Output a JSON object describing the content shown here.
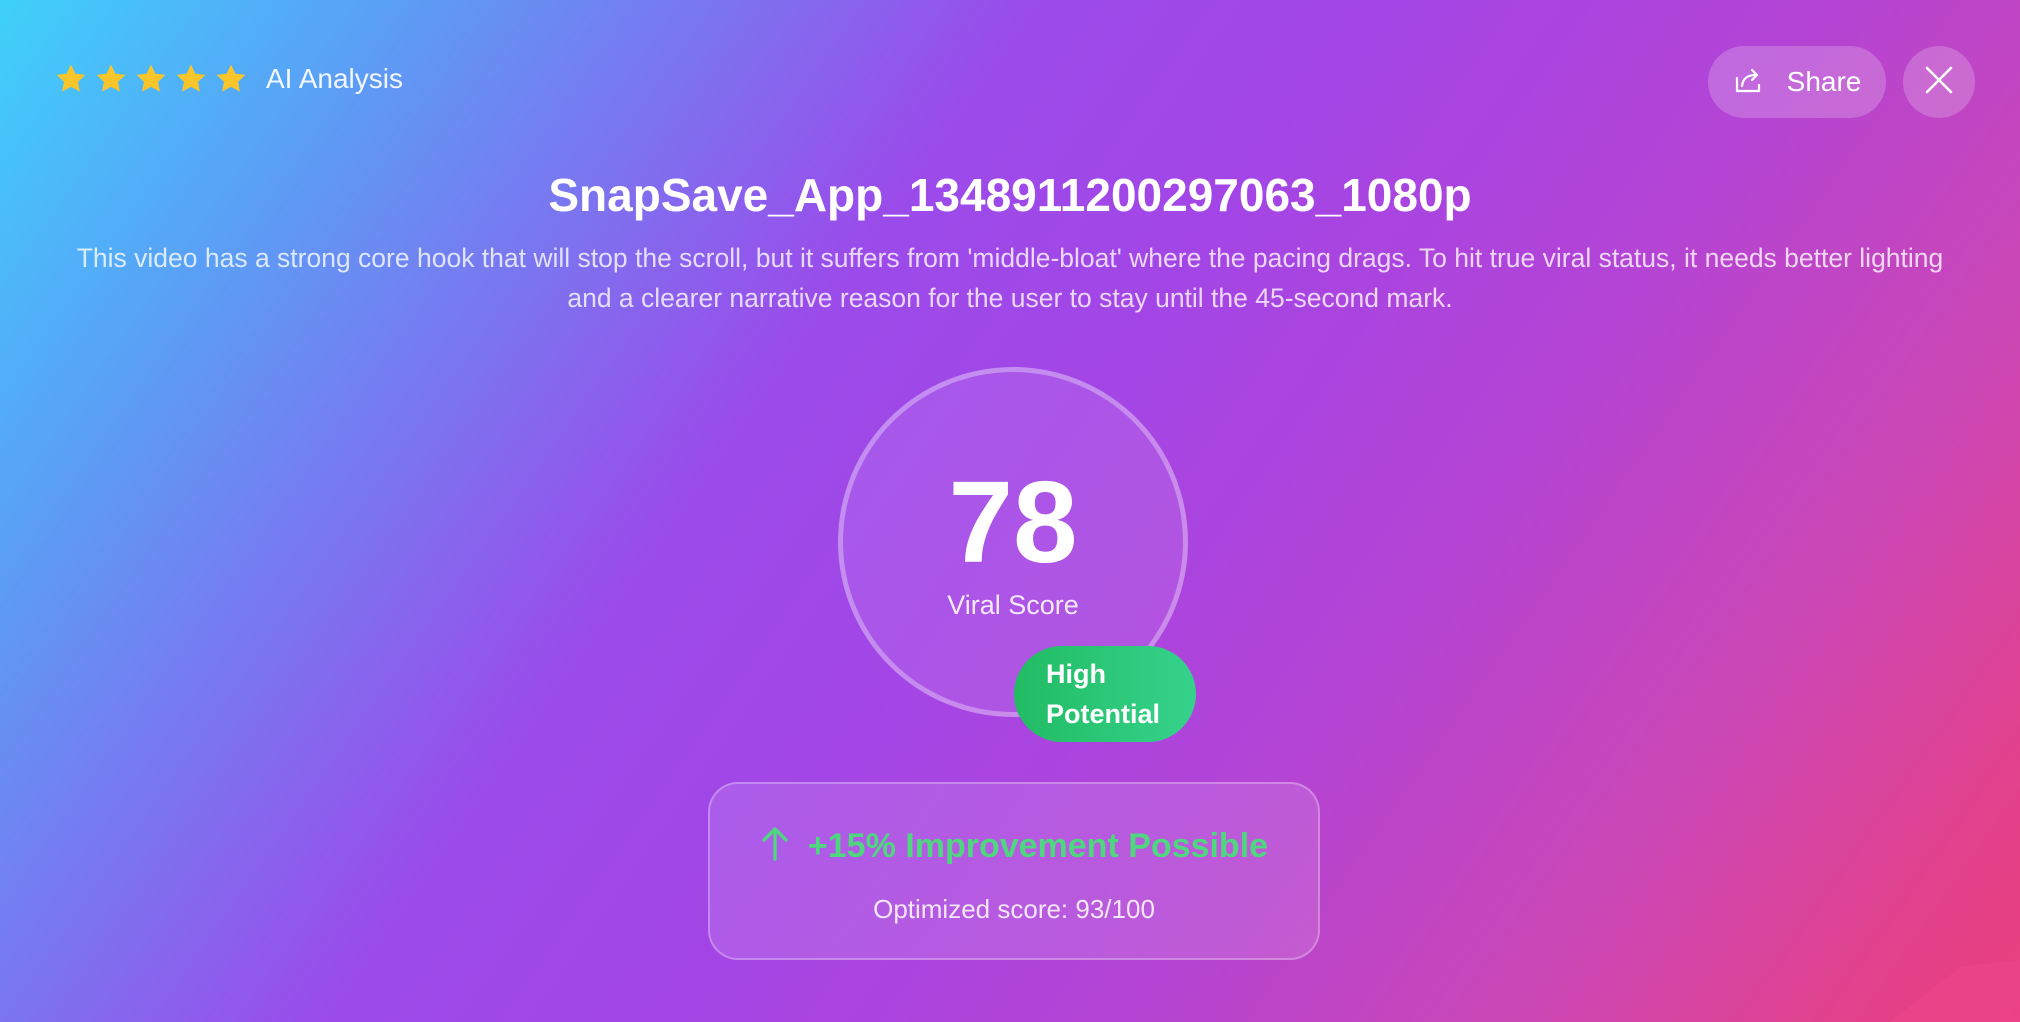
{
  "header": {
    "rating_stars": 5,
    "ai_label": "AI Analysis",
    "share_label": "Share"
  },
  "video": {
    "title": "SnapSave_App_1348911200297063_1080p",
    "summary": "This video has a strong core hook that will stop the scroll, but it suffers from 'middle-bloat' where the pacing drags. To hit true viral status, it needs better lighting and a clearer narrative reason for the user to stay until the 45-second mark."
  },
  "score": {
    "value": "78",
    "label": "Viral Score",
    "badge": "High Potential"
  },
  "improvement": {
    "headline": "+15% Improvement Possible",
    "optimized": "Optimized score: 93/100"
  },
  "colors": {
    "star": "#f8c52b",
    "badge_green": "#21bc62",
    "improvement_green": "#4fd77f"
  },
  "icons": {
    "share": "share-icon",
    "close": "close-icon",
    "arrow": "arrow-up-icon",
    "star": "star-icon"
  }
}
